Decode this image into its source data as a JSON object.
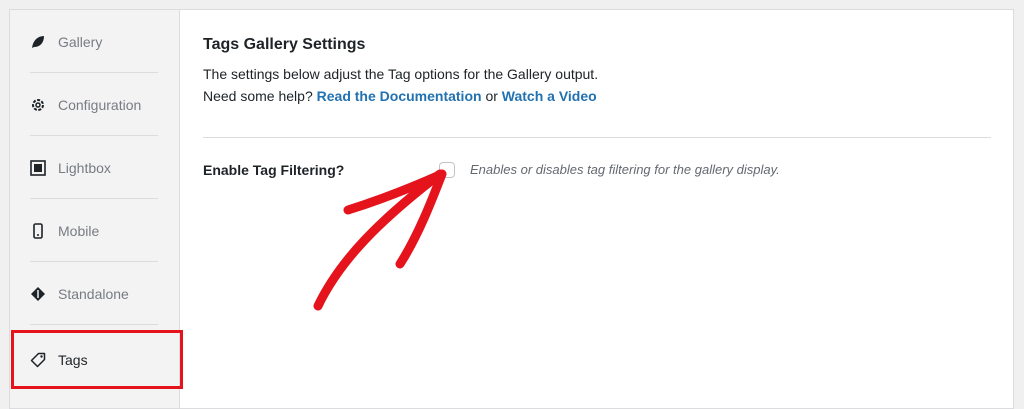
{
  "sidebar": {
    "items": [
      {
        "label": "Gallery",
        "icon": "leaf-icon"
      },
      {
        "label": "Configuration",
        "icon": "gear-icon"
      },
      {
        "label": "Lightbox",
        "icon": "lightbox-icon"
      },
      {
        "label": "Mobile",
        "icon": "mobile-icon"
      },
      {
        "label": "Standalone",
        "icon": "standalone-icon"
      },
      {
        "label": "Tags",
        "icon": "tag-icon"
      }
    ],
    "active": "Tags"
  },
  "main": {
    "title": "Tags Gallery Settings",
    "description": "The settings below adjust the Tag options for the Gallery output.",
    "help_prefix": "Need some help?",
    "help_link_docs": "Read the Documentation",
    "help_or": "or",
    "help_link_video": "Watch a Video",
    "field": {
      "label": "Enable Tag Filtering?",
      "checked": false,
      "help": "Enables or disables tag filtering for the gallery display."
    }
  },
  "colors": {
    "link": "#2271b1",
    "highlight": "#e5131b",
    "arrow": "#e5131b"
  }
}
